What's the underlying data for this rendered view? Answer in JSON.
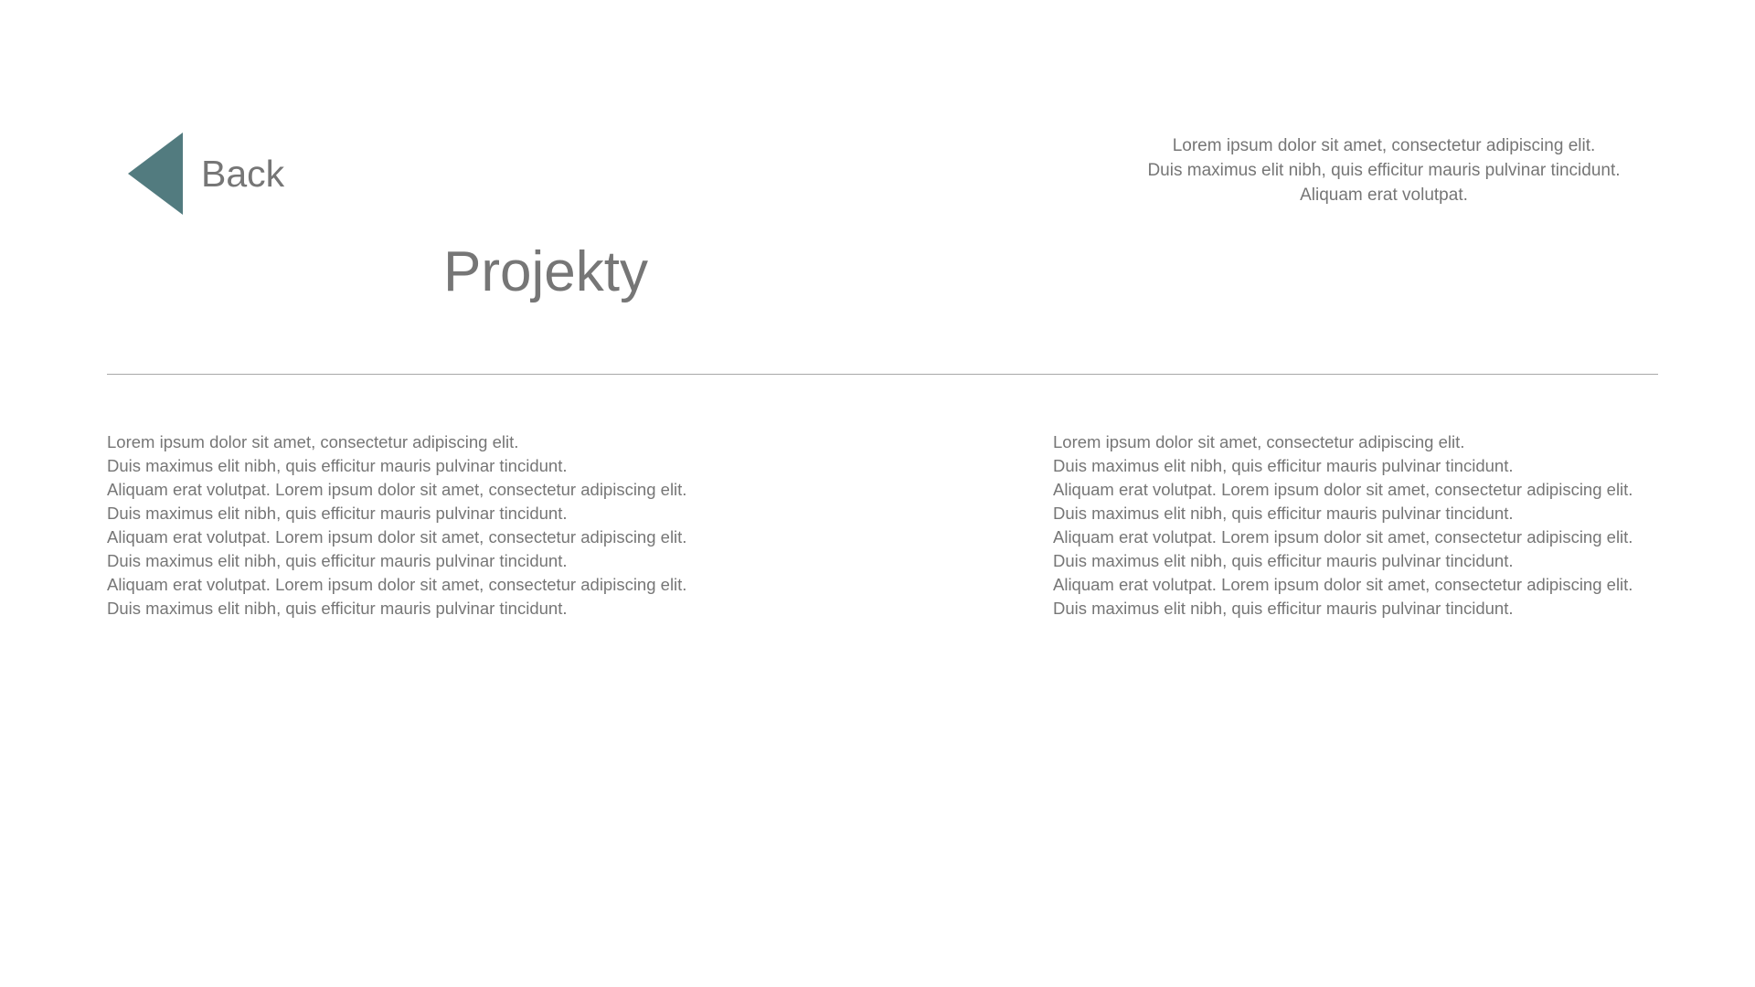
{
  "colors": {
    "accent": "#527B7F",
    "text": "#767676",
    "divider": "#A8A8A8",
    "background": "#FFFFFF"
  },
  "header": {
    "back": {
      "icon": "triangle-left-icon",
      "label": "Back"
    },
    "title": "Projekty",
    "intro_lines": [
      "Lorem ipsum dolor sit amet, consectetur adipiscing elit.",
      "Duis maximus elit nibh, quis efficitur mauris pulvinar tincidunt.",
      "Aliquam erat volutpat."
    ]
  },
  "content": {
    "left_column": [
      "Lorem ipsum dolor sit amet, consectetur adipiscing elit.",
      "Duis maximus elit nibh, quis efficitur mauris pulvinar tincidunt.",
      "Aliquam erat volutpat. Lorem ipsum dolor sit amet, consectetur adipiscing elit.",
      "Duis maximus elit nibh, quis efficitur mauris pulvinar tincidunt.",
      "Aliquam erat volutpat. Lorem ipsum dolor sit amet, consectetur adipiscing elit.",
      "Duis maximus elit nibh, quis efficitur mauris pulvinar tincidunt.",
      "Aliquam erat volutpat. Lorem ipsum dolor sit amet, consectetur adipiscing elit.",
      "Duis maximus elit nibh, quis efficitur mauris pulvinar tincidunt."
    ],
    "right_column": [
      "Lorem ipsum dolor sit amet, consectetur adipiscing elit.",
      "Duis maximus elit nibh, quis efficitur mauris pulvinar tincidunt.",
      "Aliquam erat volutpat. Lorem ipsum dolor sit amet, consectetur adipiscing elit.",
      "Duis maximus elit nibh, quis efficitur mauris pulvinar tincidunt.",
      "Aliquam erat volutpat. Lorem ipsum dolor sit amet, consectetur adipiscing elit.",
      "Duis maximus elit nibh, quis efficitur mauris pulvinar tincidunt.",
      "Aliquam erat volutpat. Lorem ipsum dolor sit amet, consectetur adipiscing elit.",
      "Duis maximus elit nibh, quis efficitur mauris pulvinar tincidunt."
    ]
  }
}
